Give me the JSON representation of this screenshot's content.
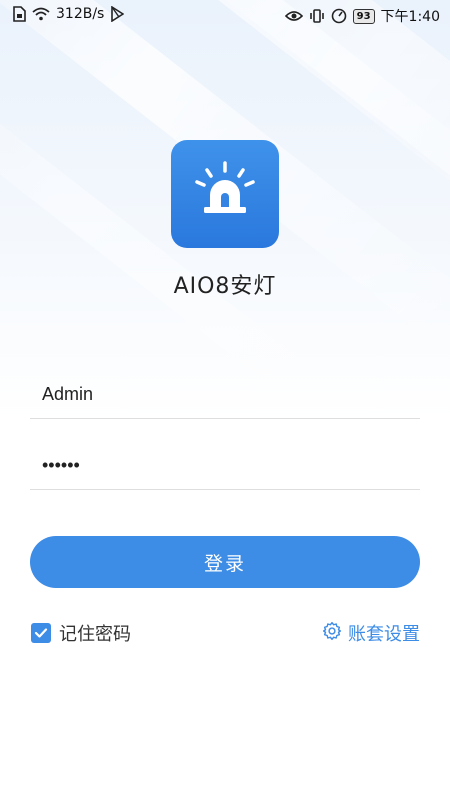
{
  "status_bar": {
    "network_speed": "312B/s",
    "battery_level": "93",
    "time": "下午1:40",
    "icons": [
      "sim-icon",
      "wifi-icon",
      "play-store-icon",
      "eye-icon",
      "vibrate-icon",
      "speedometer-icon",
      "battery-icon"
    ]
  },
  "app": {
    "name": "AIO8安灯",
    "logo_icon": "alarm-beacon-icon",
    "accent_color": "#3d8ce6"
  },
  "login": {
    "username_value": "Admin",
    "password_value": "••••••",
    "submit_label": "登录",
    "remember_label": "记住密码",
    "remember_checked": true,
    "settings_label": "账套设置",
    "settings_icon": "gear-icon"
  }
}
